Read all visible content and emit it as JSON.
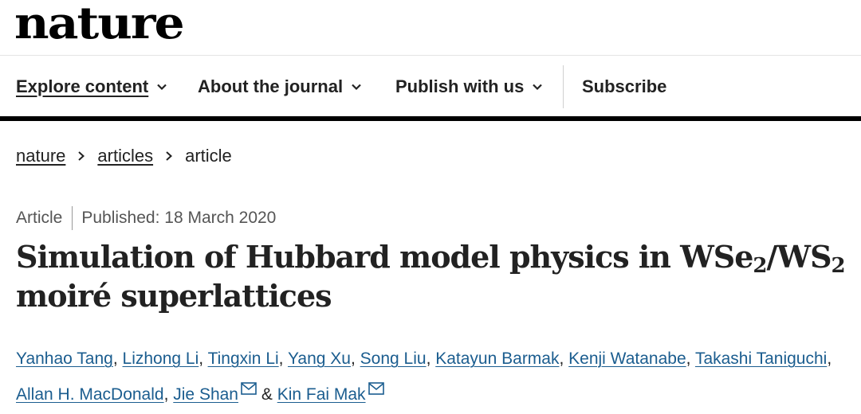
{
  "brand": {
    "logo_text": "nature"
  },
  "nav": {
    "items": [
      {
        "label": "Explore content",
        "icon": "chevron-down-icon"
      },
      {
        "label": "About the journal",
        "icon": "chevron-down-icon"
      },
      {
        "label": "Publish with us",
        "icon": "chevron-down-icon"
      },
      {
        "label": "Subscribe"
      }
    ]
  },
  "breadcrumb": {
    "items": [
      "nature",
      "articles",
      "article"
    ]
  },
  "article": {
    "type": "Article",
    "published": "Published: 18 March 2020",
    "title": {
      "part1": "Simulation of Hubbard model physics in WSe",
      "sub1": "2",
      "part2": "/WS",
      "sub2": "2",
      "part3": "moiré superlattices"
    },
    "authors": [
      "Yanhao Tang",
      "Lizhong Li",
      "Tingxin Li",
      "Yang Xu",
      "Song Liu",
      "Katayun Barmak",
      "Kenji Watanabe",
      "Takashi Taniguchi",
      "Allan H. MacDonald",
      "Jie Shan",
      "Kin Fai Mak"
    ],
    "author_separator": ", ",
    "author_last_joiner": "&",
    "email_icon": "envelope-icon"
  },
  "colors": {
    "link": "#1b5d8f",
    "rule": "#000000"
  }
}
